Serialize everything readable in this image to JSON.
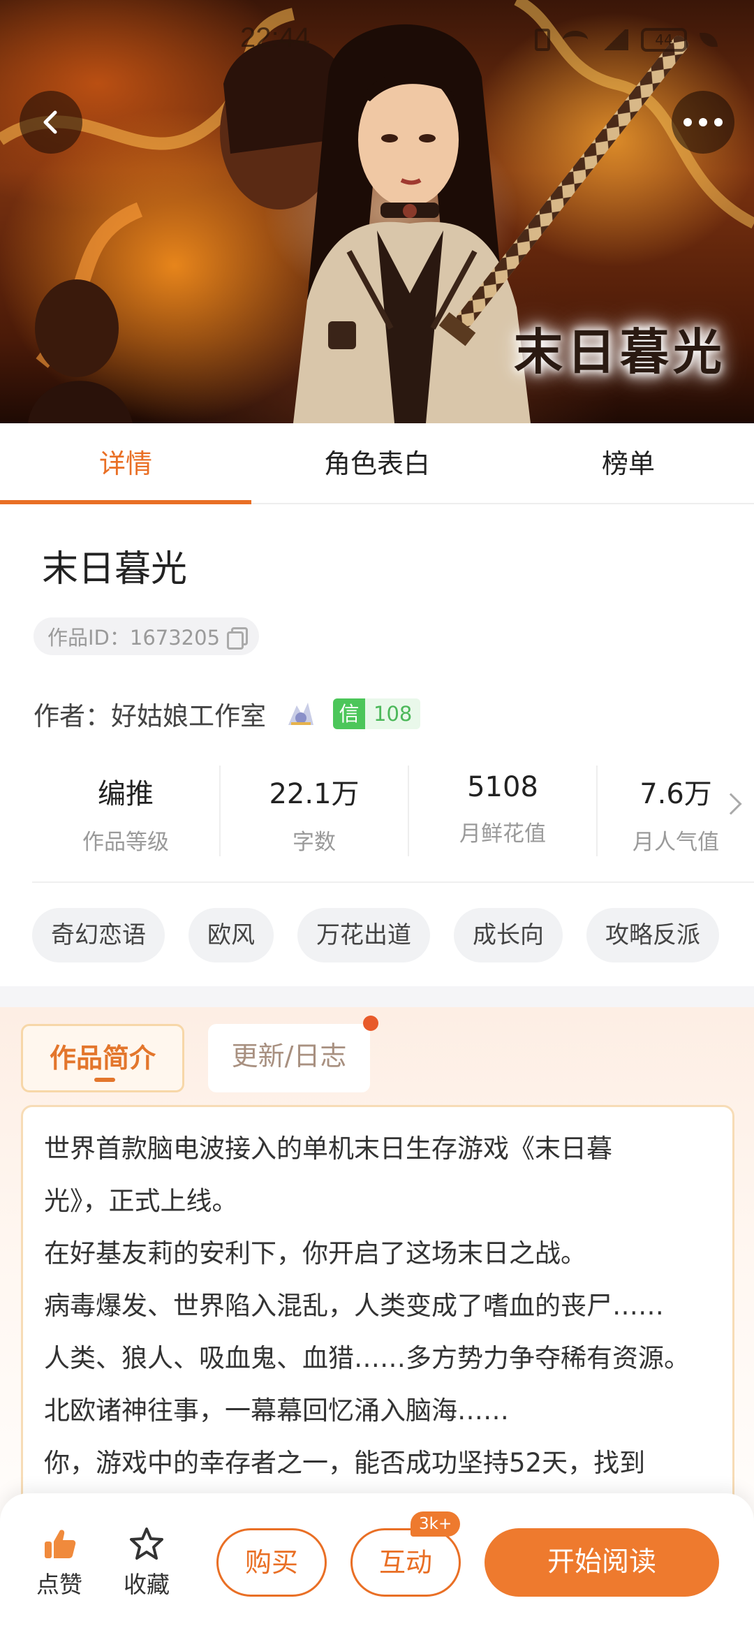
{
  "status_bar": {
    "time": "22:44",
    "battery": "44"
  },
  "hero": {
    "cover_title": "末日暮光"
  },
  "tabs": [
    {
      "label": "详情"
    },
    {
      "label": "角色表白"
    },
    {
      "label": "榜单"
    }
  ],
  "book": {
    "title": "末日暮光",
    "work_id": "作品ID：1673205",
    "author_label": "作者：好姑娘工作室",
    "trust_icon": "信",
    "trust_value": "108"
  },
  "stats": [
    {
      "value": "编推",
      "label": "作品等级"
    },
    {
      "value": "22.1万",
      "label": "字数"
    },
    {
      "value": "5108",
      "label": "月鲜花值"
    },
    {
      "value": "7.6万",
      "label": "月人气值"
    }
  ],
  "tags": [
    "奇幻恋语",
    "欧风",
    "万花出道",
    "成长向",
    "攻略反派"
  ],
  "intro_tabs": {
    "active": "作品简介",
    "inactive": "更新/日志"
  },
  "intro_lines": [
    "世界首款脑电波接入的单机末日生存游戏《末日暮",
    "光》，正式上线。",
    "在好基友莉的安利下，你开启了这场末日之战。",
    "病毒爆发、世界陷入混乱，人类变成了嗜血的丧尸……",
    "人类、狼人、吸血鬼、血猎……多方势力争夺稀有资源。",
    "北欧诸神往事，一幕幕回忆涌入脑海……",
    "你，游戏中的幸存者之一，能否成功坚持52天，找到"
  ],
  "bottom_bar": {
    "like": "点赞",
    "favorite": "收藏",
    "buy": "购买",
    "interact": "互动",
    "interact_badge": "3k+",
    "read": "开始阅读"
  },
  "colors": {
    "accent": "#e96f25",
    "trust_green": "#4cc65a"
  }
}
